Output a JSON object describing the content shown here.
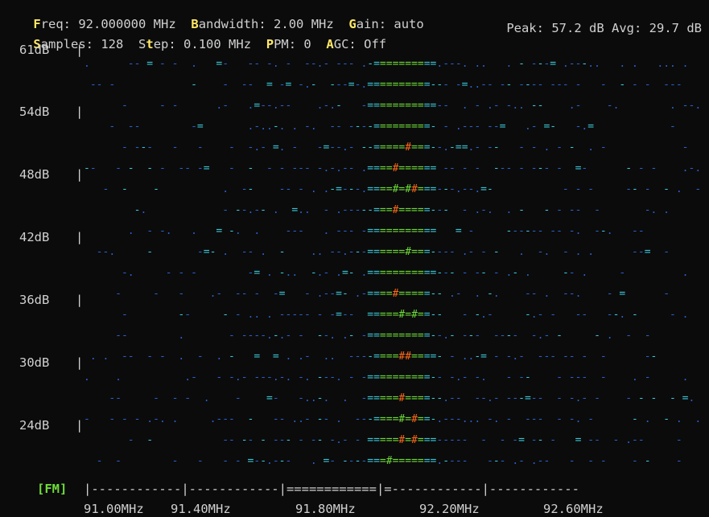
{
  "status": {
    "freq_key": "F",
    "freq_rest": "req:",
    "freq_value": "92.000000 MHz",
    "bw_key": "B",
    "bw_rest": "andwidth:",
    "bw_value": "2.00 MHz",
    "gain_key": "G",
    "gain_rest": "ain:",
    "gain_value": "auto",
    "samples_key": "S",
    "samples_rest": "amples:",
    "samples_value": "128",
    "step_pre": "S",
    "step_key": "t",
    "step_rest": "ep:",
    "step_value": "0.100 MHz",
    "ppm_key": "P",
    "ppm_rest": "PM:",
    "ppm_value": "0",
    "agc_key": "A",
    "agc_rest": "GC:",
    "agc_value": "Off",
    "peak_label": "Peak:",
    "peak_value": "57.2 dB",
    "avg_label": "Avg:",
    "avg_value": "29.7 dB"
  },
  "y_axis": [
    "61dB",
    "54dB",
    "48dB",
    "42dB",
    "36dB",
    "30dB",
    "24dB"
  ],
  "mode_tag": "[FM]",
  "freq_axis_line": "|------------|------------|============|=------------|------------",
  "freq_labels": [
    "91.00MHz",
    "91.40MHz",
    "91.80MHz",
    "92.20MHz",
    "92.60MHz"
  ],
  "colors": {
    "background": "#0b0b0b",
    "hotkey": "#ffe866",
    "mode": "#6fdc3a",
    "dim_blue": "#2a5fc9",
    "cyan": "#3cc6d6",
    "green": "#6fdc3a",
    "orange": "#ff6a1a"
  }
}
